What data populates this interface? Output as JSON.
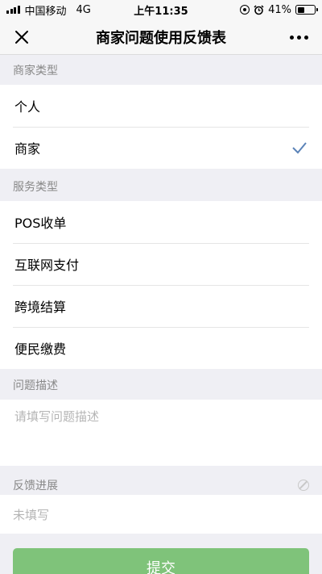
{
  "status_bar": {
    "carrier": "中国移动",
    "network": "4G",
    "time": "上午11:35",
    "battery": "41%",
    "battery_level": 0.41
  },
  "nav": {
    "title": "商家问题使用反馈表",
    "close_icon": "close-icon",
    "more_icon": "more-dots-icon"
  },
  "merchant_type": {
    "label": "商家类型",
    "options": [
      "个人",
      "商家"
    ],
    "selected": "商家"
  },
  "service_type": {
    "label": "服务类型",
    "options": [
      "POS收单",
      "互联网支付",
      "跨境结算",
      "便民缴费"
    ]
  },
  "issue_description": {
    "label": "问题描述",
    "placeholder": "请填写问题描述",
    "value": ""
  },
  "feedback_progress": {
    "label": "反馈进展",
    "value": "未填写"
  },
  "submit": {
    "label": "提交"
  },
  "colors": {
    "background": "#efeff4",
    "check": "#5b83b8",
    "submit": "#7fc37a"
  }
}
